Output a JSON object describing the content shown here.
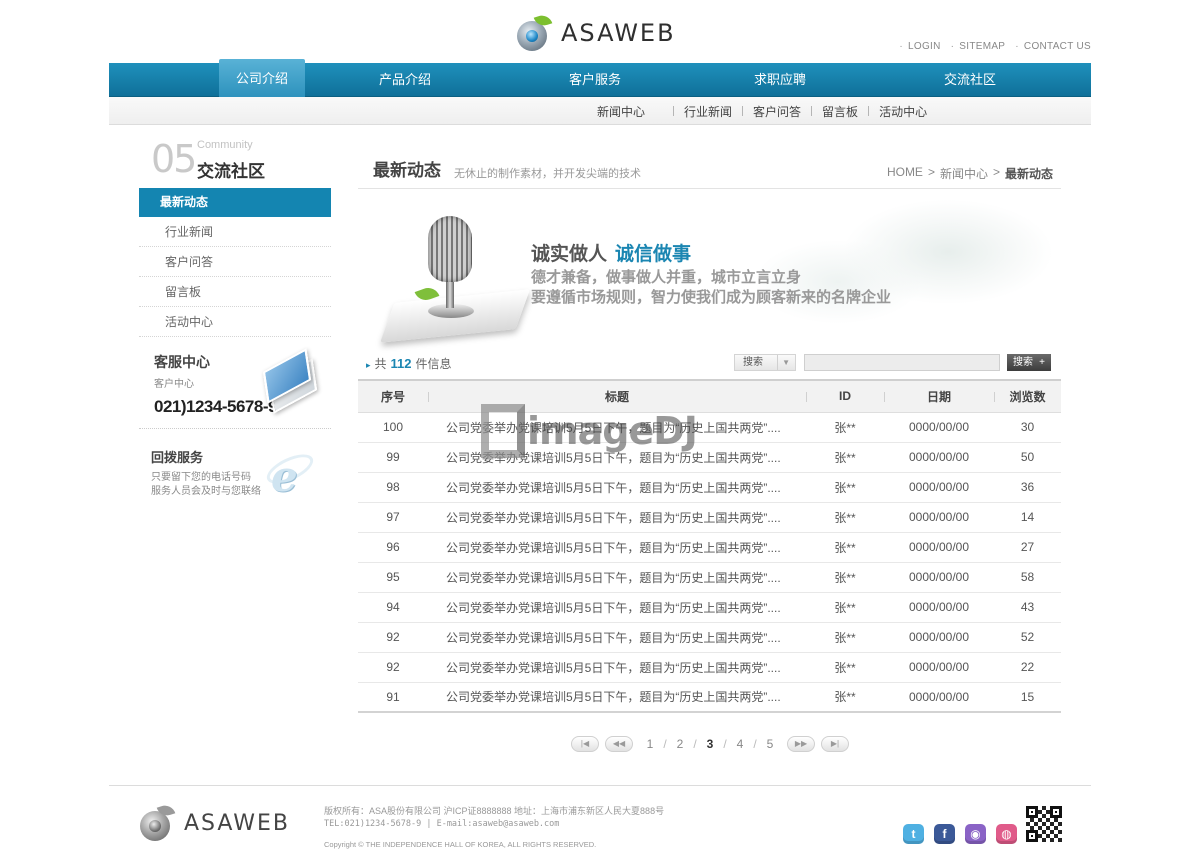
{
  "header": {
    "logo_text": "ASAWEB",
    "top_links": [
      "LOGIN",
      "SITEMAP",
      "CONTACT US"
    ]
  },
  "main_nav": [
    {
      "label": "公司介绍",
      "active": true
    },
    {
      "label": "产品介绍",
      "active": false
    },
    {
      "label": "客户服务",
      "active": false
    },
    {
      "label": "求职应聘",
      "active": false
    },
    {
      "label": "交流社区",
      "active": false
    }
  ],
  "sub_nav": [
    "新闻中心",
    "行业新闻",
    "客户问答",
    "留言板",
    "活动中心"
  ],
  "sidebar": {
    "section_number": "05",
    "section_en": "Community",
    "section_cn": "交流社区",
    "active_item": "最新动态",
    "items": [
      "行业新闻",
      "客户问答",
      "留言板",
      "活动中心"
    ],
    "service": {
      "title": "客服中心",
      "subtitle": "客户中心",
      "phone": "021)1234-5678-9"
    },
    "callback": {
      "title": "回拨服务",
      "line1": "只要留下您的电话号码",
      "line2": "服务人员会及时与您联络"
    }
  },
  "content": {
    "title": "最新动态",
    "subtitle": "无休止的制作素材，并开发尖端的技术",
    "breadcrumb": [
      "HOME",
      "新闻中心",
      "最新动态"
    ],
    "banner": {
      "line1_a": "诚实做人",
      "line1_b": "诚信做事",
      "line2": "德才兼备，做事做人并重，城市立言立身",
      "line3": "要遵循市场规则，智力使我们成为顾客新来的名牌企业"
    },
    "count_prefix": "共",
    "count": "112",
    "count_suffix": "件信息",
    "search": {
      "select_label": "搜索",
      "button_label": "搜索"
    },
    "table": {
      "headers": [
        "序号",
        "标题",
        "ID",
        "日期",
        "浏览数"
      ],
      "rows": [
        {
          "no": "100",
          "title": "公司党委举办党课培训5月5日下午，题目为“历史上国共两党”....",
          "id": "张**",
          "date": "0000/00/00",
          "views": "30"
        },
        {
          "no": "99",
          "title": "公司党委举办党课培训5月5日下午，题目为“历史上国共两党”....",
          "id": "张**",
          "date": "0000/00/00",
          "views": "50"
        },
        {
          "no": "98",
          "title": "公司党委举办党课培训5月5日下午，题目为“历史上国共两党”....",
          "id": "张**",
          "date": "0000/00/00",
          "views": "36"
        },
        {
          "no": "97",
          "title": "公司党委举办党课培训5月5日下午，题目为“历史上国共两党”....",
          "id": "张**",
          "date": "0000/00/00",
          "views": "14"
        },
        {
          "no": "96",
          "title": "公司党委举办党课培训5月5日下午，题目为“历史上国共两党”....",
          "id": "张**",
          "date": "0000/00/00",
          "views": "27"
        },
        {
          "no": "95",
          "title": "公司党委举办党课培训5月5日下午，题目为“历史上国共两党”....",
          "id": "张**",
          "date": "0000/00/00",
          "views": "58"
        },
        {
          "no": "94",
          "title": "公司党委举办党课培训5月5日下午，题目为“历史上国共两党”....",
          "id": "张**",
          "date": "0000/00/00",
          "views": "43"
        },
        {
          "no": "92",
          "title": "公司党委举办党课培训5月5日下午，题目为“历史上国共两党”....",
          "id": "张**",
          "date": "0000/00/00",
          "views": "52"
        },
        {
          "no": "92",
          "title": "公司党委举办党课培训5月5日下午，题目为“历史上国共两党”....",
          "id": "张**",
          "date": "0000/00/00",
          "views": "22"
        },
        {
          "no": "91",
          "title": "公司党委举办党课培训5月5日下午，题目为“历史上国共两党”....",
          "id": "张**",
          "date": "0000/00/00",
          "views": "15"
        }
      ]
    },
    "pagination": {
      "pages": [
        "1",
        "2",
        "3",
        "4",
        "5"
      ],
      "current": "3"
    }
  },
  "watermark": "imageDJ",
  "footer": {
    "logo_text": "ASAWEB",
    "line1": "版权所有：ASA股份有限公司 沪ICP证8888888 地址：上海市浦东新区人民大夏888号",
    "line2": "TEL:021)1234-5678-9 | E-mail:asaweb@asaweb.com",
    "line3": "Copyright © THE INDEPENDENCE HALL OF KOREA, ALL RIGHTS RESERVED.",
    "social": [
      {
        "name": "twitter",
        "glyph": "t",
        "color": "#4fb0e2"
      },
      {
        "name": "facebook",
        "glyph": "f",
        "color": "#3b5998"
      },
      {
        "name": "myspace",
        "glyph": "◉",
        "color": "#8a63c6"
      },
      {
        "name": "weibo",
        "glyph": "◍",
        "color": "#e05b8a"
      }
    ]
  }
}
